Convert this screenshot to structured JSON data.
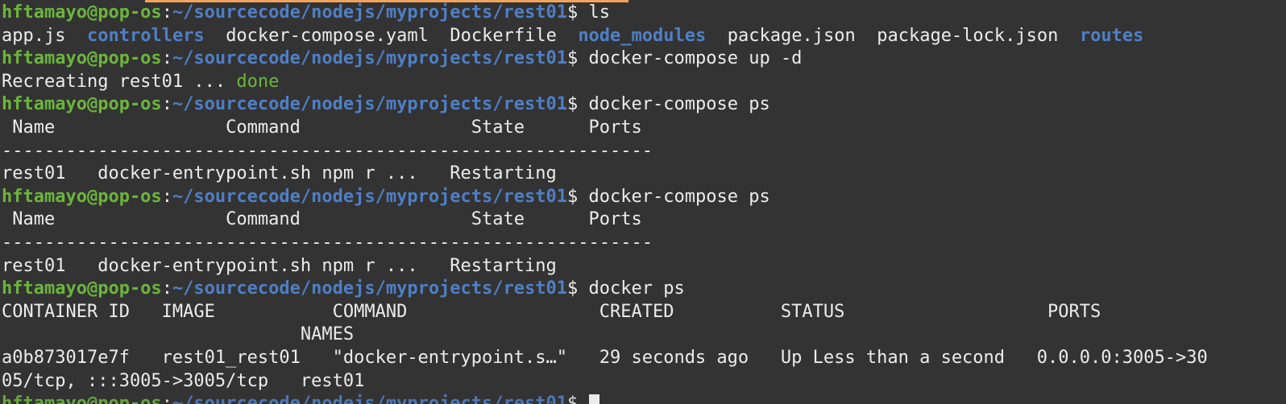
{
  "prompt": {
    "user": "hftamayo@pop-os",
    "colon": ":",
    "path": "~/sourcecode/nodejs/myprojects/rest01",
    "dollar": "$ "
  },
  "lines": {
    "l1_cmd": "ls",
    "ls_files": [
      "app.js",
      "controllers",
      "docker-compose.yaml",
      "Dockerfile",
      "node_modules",
      "package.json",
      "package-lock.json",
      "routes"
    ],
    "l3_cmd": "docker-compose up -d",
    "recreate_text": "Recreating rest01 ... ",
    "recreate_done": "done",
    "l5_cmd": "docker-compose ps",
    "ps_header": " Name                Command                State      Ports",
    "ps_sep": "-------------------------------------------------------------",
    "ps_row": "rest01   docker-entrypoint.sh npm r ...   Restarting",
    "l9_cmd": "docker-compose ps",
    "ps_header2": " Name                Command                State      Ports",
    "ps_sep2": "-------------------------------------------------------------",
    "ps_row2": "rest01   docker-entrypoint.sh npm r ...   Restarting",
    "l13_cmd": "docker ps",
    "dps_header1": "CONTAINER ID   IMAGE           COMMAND                  CREATED          STATUS                   PORTS",
    "dps_header2": "                            NAMES",
    "dps_row1": "a0b873017e7f   rest01_rest01   \"docker-entrypoint.s…\"   29 seconds ago   Up Less than a second   0.0.0.0:3005->30",
    "dps_row2": "05/tcp, :::3005->3005/tcp   rest01"
  },
  "colors": {
    "background": "#333333",
    "user": "#6bb53c",
    "path": "#4f7fc6",
    "text": "#ececec",
    "accent": "#f0a35c"
  }
}
